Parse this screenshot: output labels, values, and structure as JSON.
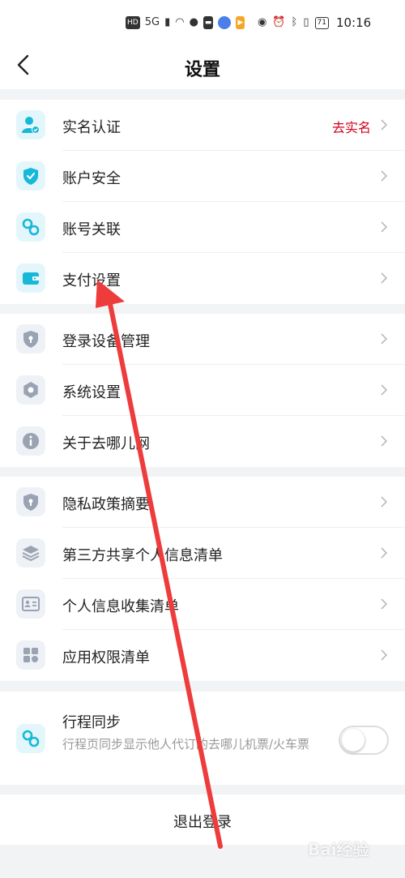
{
  "status_bar": {
    "left_icons": [
      "HD",
      "5G",
      "signal-icon",
      "wifi-icon",
      "chat-icon",
      "mail-icon",
      "app-icon",
      "video-icon"
    ],
    "right_icons": [
      "eye-icon",
      "alarm-icon",
      "bluetooth-icon",
      "vibrate-icon"
    ],
    "battery": "71",
    "time": "10:16"
  },
  "nav": {
    "title": "设置"
  },
  "group1": [
    {
      "label": "实名认证",
      "extra": "去实名",
      "icon": "user-verified-icon"
    },
    {
      "label": "账户安全",
      "icon": "shield-check-icon"
    },
    {
      "label": "账号关联",
      "icon": "link-icon"
    },
    {
      "label": "支付设置",
      "icon": "wallet-icon"
    }
  ],
  "group2": [
    {
      "label": "登录设备管理",
      "icon": "device-shield-icon"
    },
    {
      "label": "系统设置",
      "icon": "gear-icon"
    },
    {
      "label": "关于去哪儿网",
      "icon": "info-icon"
    }
  ],
  "group3": [
    {
      "label": "隐私政策摘要",
      "icon": "privacy-shield-icon"
    },
    {
      "label": "第三方共享个人信息清单",
      "icon": "layers-icon"
    },
    {
      "label": "个人信息收集清单",
      "icon": "id-card-icon"
    },
    {
      "label": "应用权限清单",
      "icon": "grid-icon"
    }
  ],
  "sync": {
    "title": "行程同步",
    "desc": "行程页同步显示他人代订的去哪儿机票/火车票",
    "enabled": false
  },
  "logout": {
    "label": "退出登录"
  },
  "watermark": "Bai经验",
  "colors": {
    "accent": "#17b8d8",
    "extra_text": "#d0021b",
    "annotation_arrow": "#ee3b3b"
  }
}
